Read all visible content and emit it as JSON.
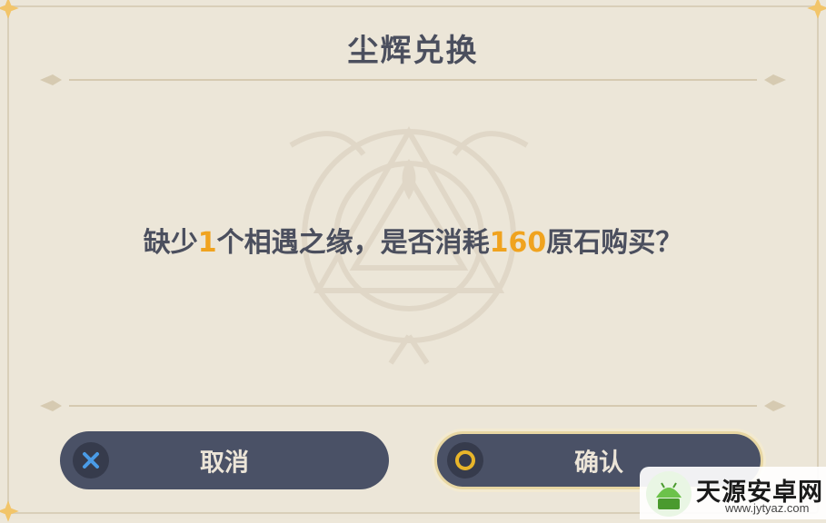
{
  "dialog": {
    "title": "尘辉兑换",
    "message": {
      "part1": "缺少",
      "count": "1",
      "part2": "个相遇之缘，是否消耗",
      "cost": "160",
      "part3": "原石购买？"
    }
  },
  "buttons": {
    "cancel_label": "取消",
    "confirm_label": "确认"
  },
  "watermark": {
    "name": "天源安卓网",
    "url": "www.jytyaz.com"
  },
  "colors": {
    "background": "#ece6d8",
    "text": "#4b4f5e",
    "highlight": "#f0a31f",
    "button": "#4a5166",
    "cancel_icon": "#4a9be6",
    "confirm_icon": "#e8b52a"
  }
}
